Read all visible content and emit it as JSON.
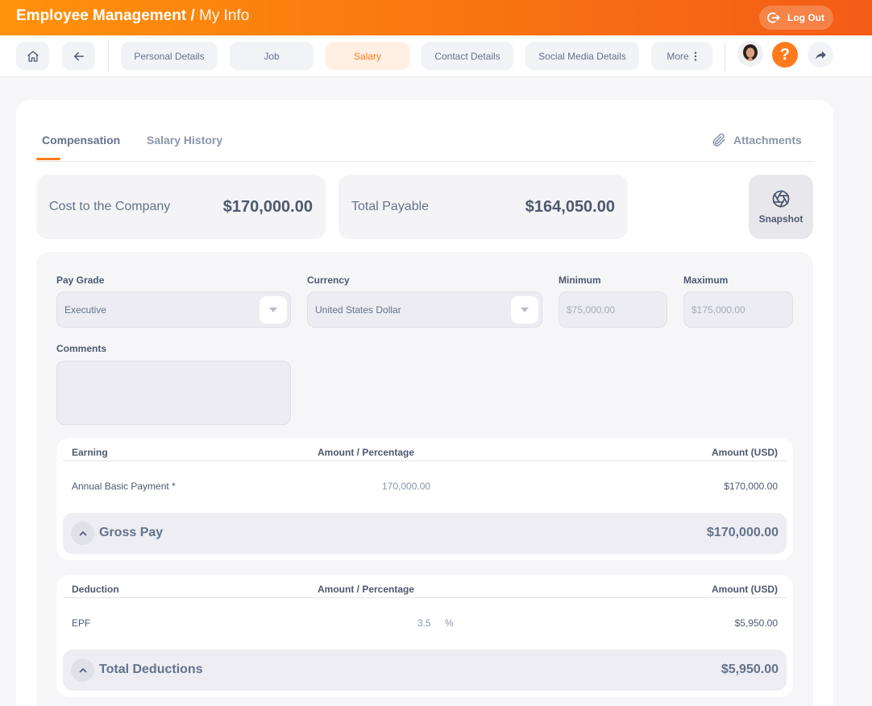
{
  "header": {
    "title": "Employee Management",
    "separator": "/",
    "subtitle": "My Info",
    "logout_label": "Log Out",
    "gradient_start": "#ff920b",
    "gradient_end": "#f35c17"
  },
  "nav": {
    "home_icon": "home-icon",
    "back_icon": "arrow-left-icon",
    "tabs": [
      {
        "label": "Personal Details",
        "active": false
      },
      {
        "label": "Job",
        "active": false
      },
      {
        "label": "Salary",
        "active": true
      },
      {
        "label": "Contact Details",
        "active": false
      },
      {
        "label": "Social Media Details",
        "active": false
      }
    ],
    "more_label": "More",
    "help_label": "?",
    "accent_color": "#ff7b1d"
  },
  "content": {
    "tabs": [
      {
        "label": "Compensation",
        "active": true
      },
      {
        "label": "Salary History",
        "active": false
      }
    ],
    "attachments_label": "Attachments",
    "summary": {
      "cost_label": "Cost to the Company",
      "cost_value": "$170,000.00",
      "payable_label": "Total Payable",
      "payable_value": "$164,050.00",
      "snapshot_label": "Snapshot"
    },
    "form": {
      "pay_grade_label": "Pay Grade",
      "pay_grade_value": "Executive",
      "currency_label": "Currency",
      "currency_value": "United States Dollar",
      "minimum_label": "Minimum",
      "minimum_value": "$75,000.00",
      "maximum_label": "Maximum",
      "maximum_value": "$175,000.00",
      "comments_label": "Comments",
      "comments_value": ""
    },
    "earnings": {
      "col_name": "Earning",
      "col_amount": "Amount / Percentage",
      "col_usd": "Amount (USD)",
      "row_name": "Annual Basic Payment *",
      "row_amount": "170,000.00",
      "row_usd": "$170,000.00",
      "total_label": "Gross Pay",
      "total_value": "$170,000.00"
    },
    "deductions": {
      "col_name": "Deduction",
      "col_amount": "Amount / Percentage",
      "col_usd": "Amount (USD)",
      "row_name": "EPF",
      "row_amount": "3.5",
      "row_unit": "%",
      "row_usd": "$5,950.00",
      "total_label": "Total Deductions",
      "total_value": "$5,950.00"
    }
  }
}
